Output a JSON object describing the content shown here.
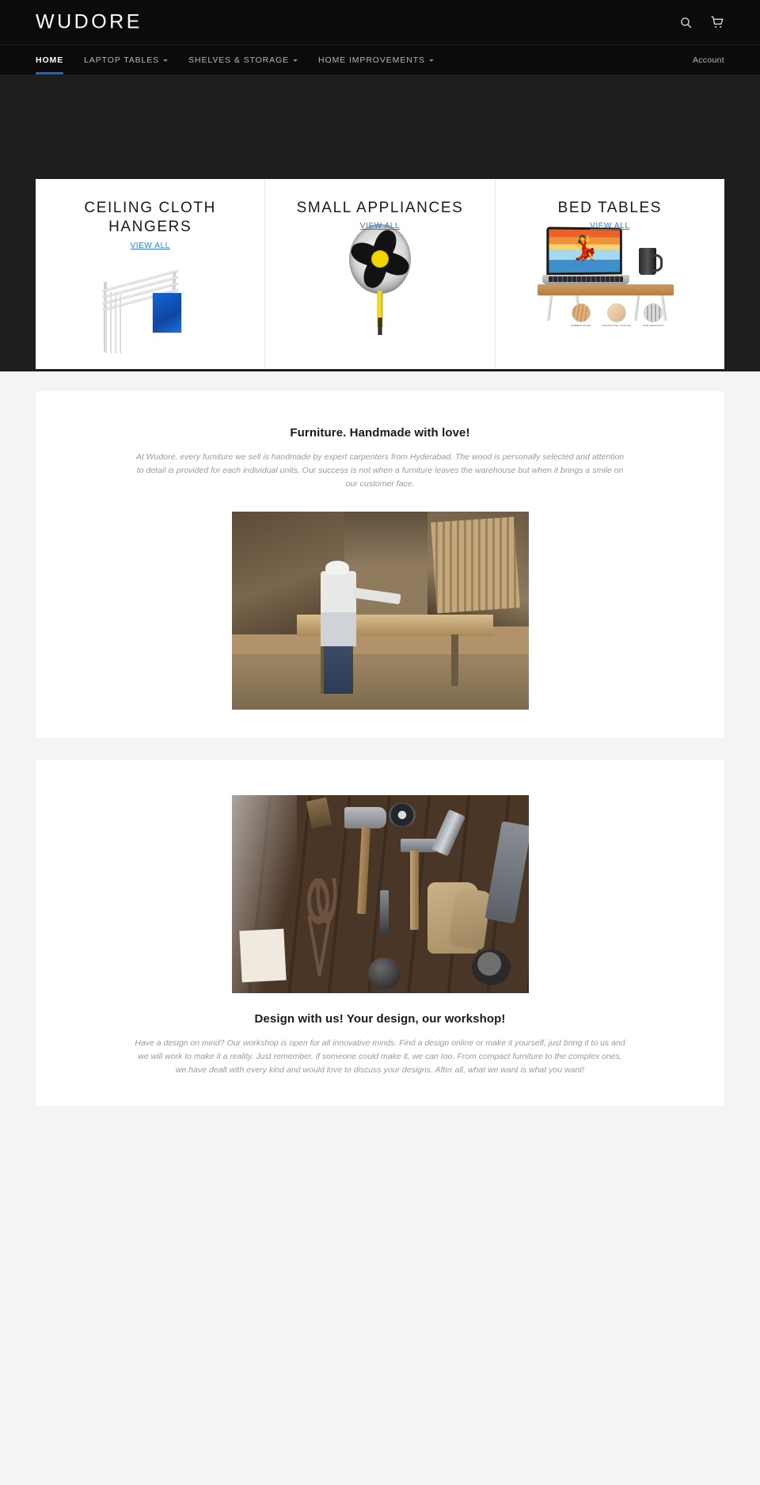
{
  "header": {
    "brand": "WUDORE",
    "search_icon": "search-icon",
    "cart_icon": "cart-icon"
  },
  "nav": {
    "items": [
      {
        "label": "Home",
        "has_dropdown": false,
        "active": true
      },
      {
        "label": "Laptop Tables",
        "has_dropdown": true,
        "active": false
      },
      {
        "label": "Shelves & Storage",
        "has_dropdown": true,
        "active": false
      },
      {
        "label": "Home Improvements",
        "has_dropdown": true,
        "active": false
      }
    ],
    "account_label": "Account",
    "active_underline_color": "#1d60d4"
  },
  "categories": {
    "link_color": "#2b7fd4",
    "cards": [
      {
        "title": "CEILING CLOTH HANGERS",
        "link_label": "VIEW ALL",
        "art": "ceiling-cloth-hanger-illustration"
      },
      {
        "title": "SMALL APPLIANCES",
        "link_label": "VIEW ALL",
        "art": "pedestal-fan-photo"
      },
      {
        "title": "BED TABLES",
        "link_label": "VIEW ALL",
        "art": "bed-table-with-laptop-photo",
        "swatches": [
          {
            "label": "RUBBER WOOD"
          },
          {
            "label": "PROTECTIVE COATING"
          },
          {
            "label": "SKID RESISTANT"
          }
        ]
      }
    ]
  },
  "sections": [
    {
      "heading": "Furniture. Handmade with love!",
      "text": "At Wudore, every furniture we sell is handmade by expert carpenters from Hyderabad. The wood is personally selected and attention to detail is provided for each individual units. Our success is not when a furniture leaves the warehouse but when it brings a smile on our customer face.",
      "image": "carpenter-working-in-workshop-photo"
    },
    {
      "heading": "Design with us! Your design, our workshop!",
      "text": "Have a design on mind? Our workshop is open for all innovative minds. Find a design online or make it yourself, just bring it to us and we will work to make it a reality. Just remember, if someone could make it, we can too. From compact furniture to the complex ones, we have dealt with every kind and would love to discuss your designs. After all, what we want is what you want!",
      "image": "vintage-hand-tools-flat-lay-photo"
    }
  ]
}
